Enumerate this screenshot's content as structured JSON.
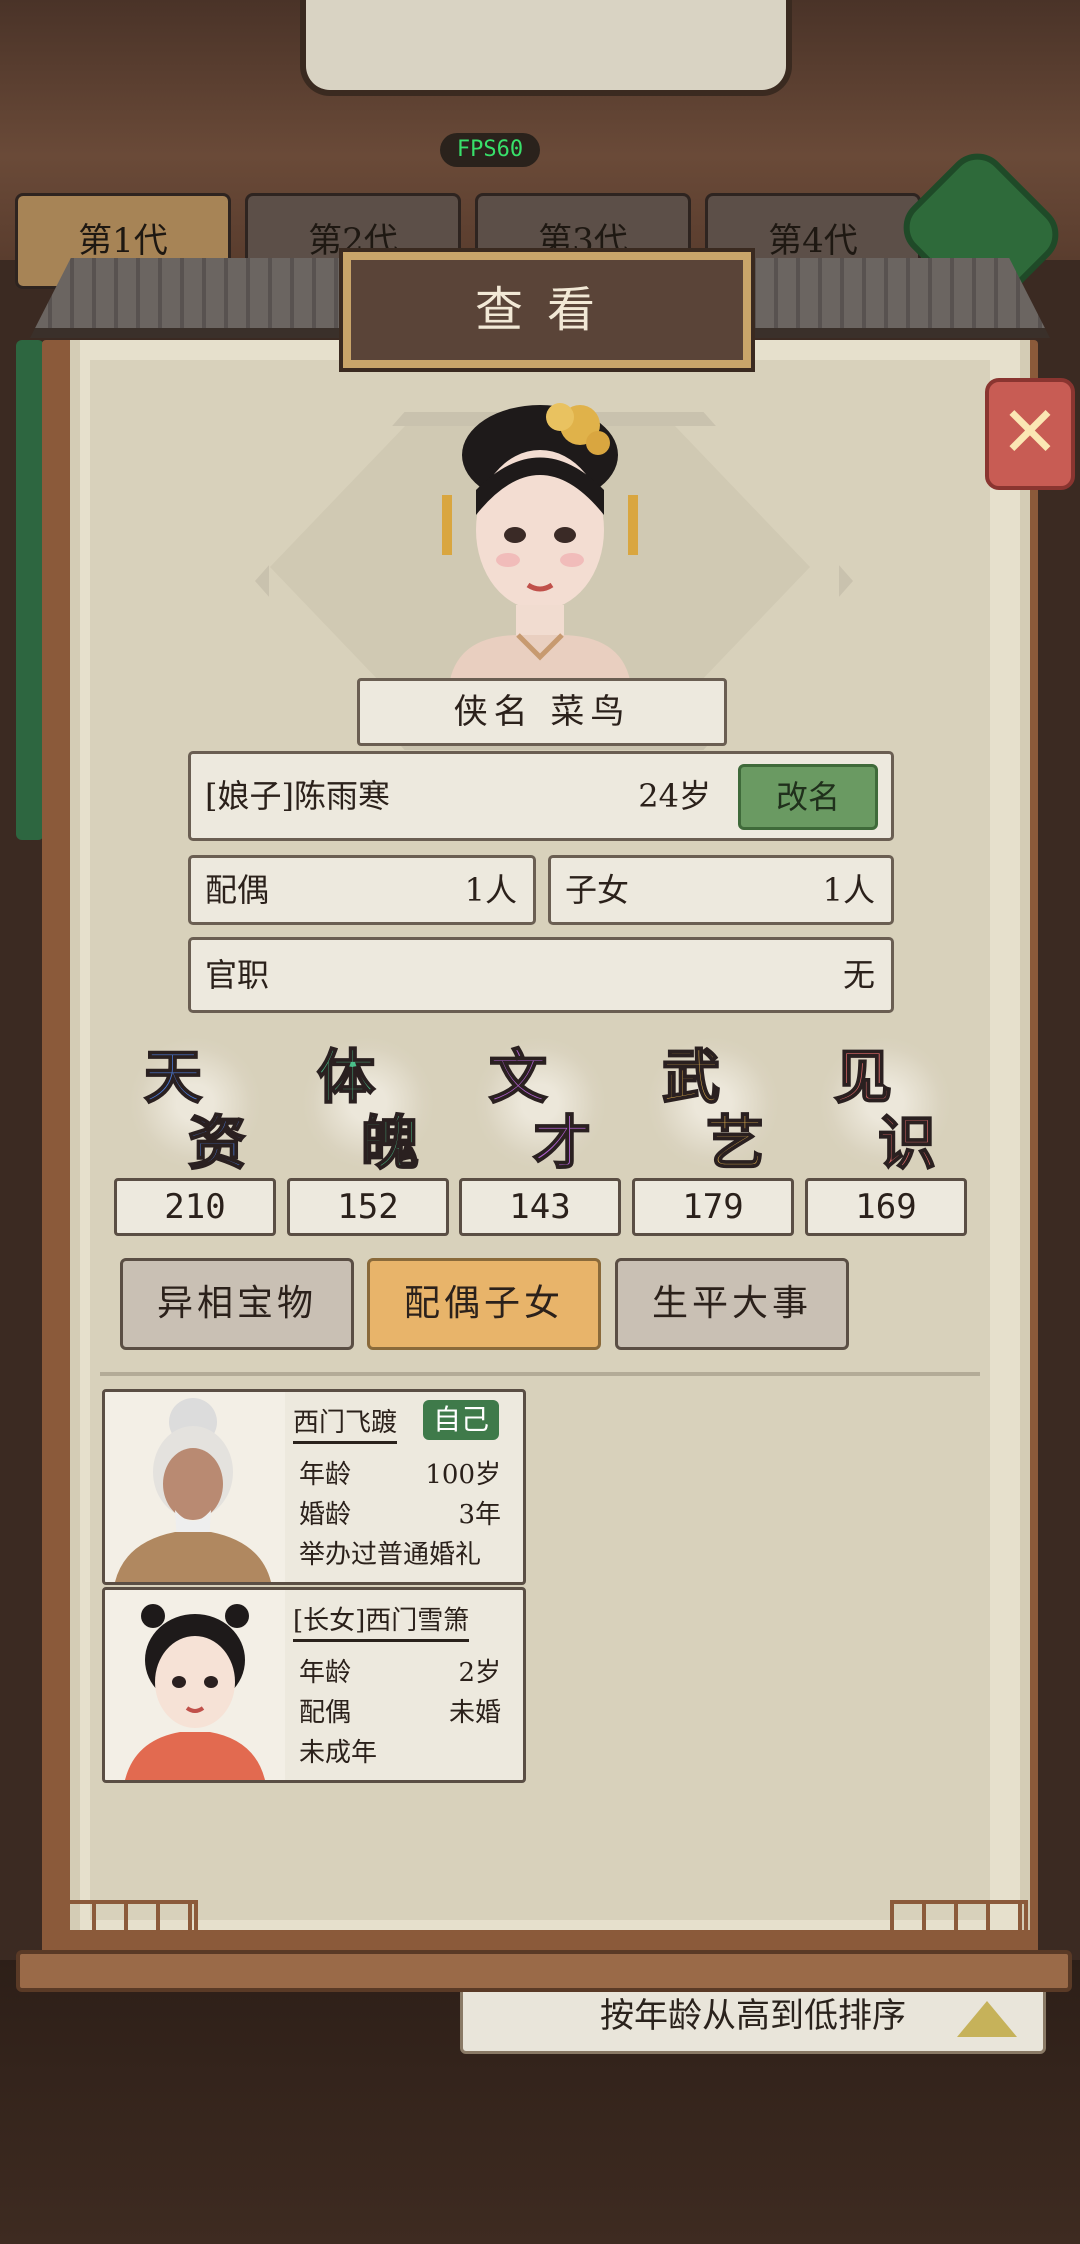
{
  "hud": {
    "fps": "FPS60"
  },
  "generations": [
    "第1代",
    "第2代",
    "第3代",
    "第4代"
  ],
  "sort_label": "按年龄从高到低排序",
  "dialog": {
    "title": "查看",
    "close_glyph": "✕"
  },
  "character": {
    "title_name": "侠名 菜鸟",
    "full_name": "[娘子]陈雨寒",
    "age": "24岁",
    "rename_label": "改名",
    "spouse_label": "配偶",
    "spouse_count": "1人",
    "children_label": "子女",
    "children_count": "1人",
    "office_label": "官职",
    "office_value": "无"
  },
  "stats": [
    {
      "c1": "天",
      "c2": "资",
      "value": "210",
      "color": "#4a7ad8"
    },
    {
      "c1": "体",
      "c2": "魄",
      "value": "152",
      "color": "#4ac08a"
    },
    {
      "c1": "文",
      "c2": "才",
      "value": "143",
      "color": "#b060d0"
    },
    {
      "c1": "武",
      "c2": "艺",
      "value": "179",
      "color": "#e0b050"
    },
    {
      "c1": "见",
      "c2": "识",
      "value": "169",
      "color": "#e06a6a"
    }
  ],
  "tabs": [
    "异相宝物",
    "配偶子女",
    "生平大事"
  ],
  "family": [
    {
      "name": "西门飞踱",
      "badge": "自己",
      "line1_label": "年龄",
      "line1_value": "100岁",
      "line2_label": "婚龄",
      "line2_value": "3年",
      "line3": "举办过普通婚礼"
    },
    {
      "name": "[长女]西门雪箫",
      "badge": "",
      "line1_label": "年龄",
      "line1_value": "2岁",
      "line2_label": "配偶",
      "line2_value": "未婚",
      "line3": "未成年"
    }
  ]
}
